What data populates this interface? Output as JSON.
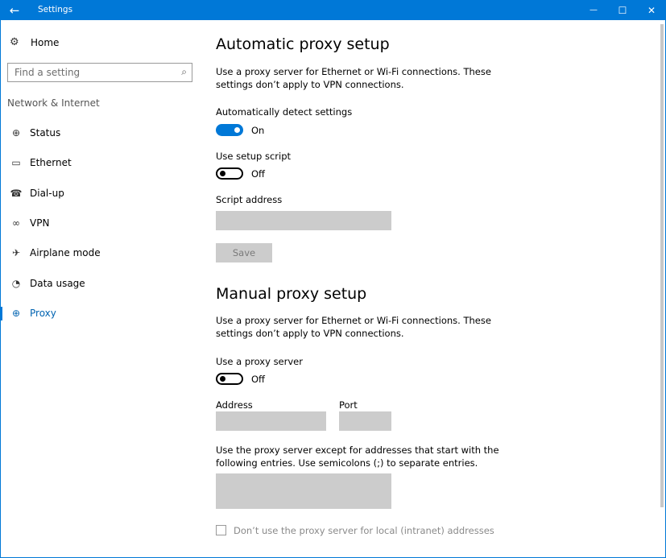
{
  "window": {
    "title": "Settings",
    "back_glyph": "←",
    "minimize_glyph": "—",
    "maximize_glyph": "☐",
    "close_glyph": "✕",
    "accent_color": "#0078d7"
  },
  "sidebar": {
    "home_label": "Home",
    "home_icon": "gear-icon",
    "search_placeholder": "Find a setting",
    "search_icon": "search-icon",
    "group_label": "Network & Internet",
    "items": [
      {
        "label": "Status",
        "icon": "globe-status-icon",
        "glyph": "⊕",
        "active": false
      },
      {
        "label": "Ethernet",
        "icon": "ethernet-icon",
        "glyph": "▭",
        "active": false
      },
      {
        "label": "Dial-up",
        "icon": "dialup-icon",
        "glyph": "☎",
        "active": false
      },
      {
        "label": "VPN",
        "icon": "vpn-icon",
        "glyph": "∞",
        "active": false
      },
      {
        "label": "Airplane mode",
        "icon": "airplane-icon",
        "glyph": "✈",
        "active": false
      },
      {
        "label": "Data usage",
        "icon": "pie-chart-icon",
        "glyph": "◔",
        "active": false
      },
      {
        "label": "Proxy",
        "icon": "globe-icon",
        "glyph": "⊕",
        "active": true
      }
    ]
  },
  "main": {
    "auto": {
      "heading": "Automatic proxy setup",
      "description": "Use a proxy server for Ethernet or Wi-Fi connections. These settings don’t apply to VPN connections.",
      "detect_label": "Automatically detect settings",
      "detect_state": "On",
      "script_label": "Use setup script",
      "script_state": "Off",
      "address_label": "Script address",
      "address_value": "",
      "save_label": "Save"
    },
    "manual": {
      "heading": "Manual proxy setup",
      "description": "Use a proxy server for Ethernet or Wi-Fi connections. These settings don’t apply to VPN connections.",
      "use_label": "Use a proxy server",
      "use_state": "Off",
      "address_label": "Address",
      "address_value": "",
      "port_label": "Port",
      "port_value": "",
      "exceptions_desc": "Use the proxy server except for addresses that start with the following entries. Use semicolons (;) to separate entries.",
      "exceptions_value": "",
      "local_checkbox_label": "Don’t use the proxy server for local (intranet) addresses",
      "local_checkbox_checked": false
    }
  }
}
